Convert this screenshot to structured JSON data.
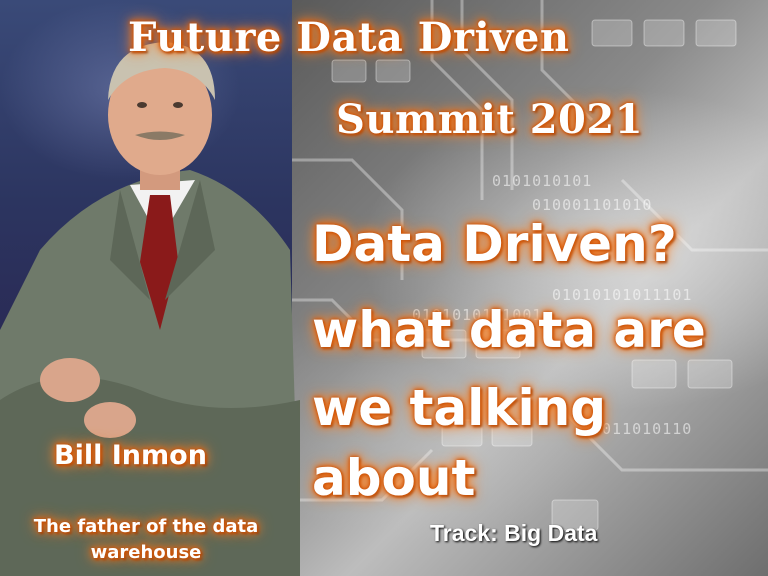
{
  "title": {
    "line1": "Future Data Driven",
    "line2": "Summit 2021"
  },
  "talk": {
    "lines": [
      "Data Driven?",
      "what data are",
      "we talking",
      "about"
    ]
  },
  "speaker": {
    "name": "Bill Inmon",
    "role": "The father of the data warehouse"
  },
  "track": "Track: Big Data",
  "decor": {
    "binary_rows": [
      "0101010101",
      "010001101010",
      "01010101011101",
      "0101010101001",
      "1011010110"
    ]
  },
  "colors": {
    "text": "#ffffff",
    "glow": "#f07a20",
    "suit": "#6f7a6a",
    "tie": "#8a1a1a"
  }
}
